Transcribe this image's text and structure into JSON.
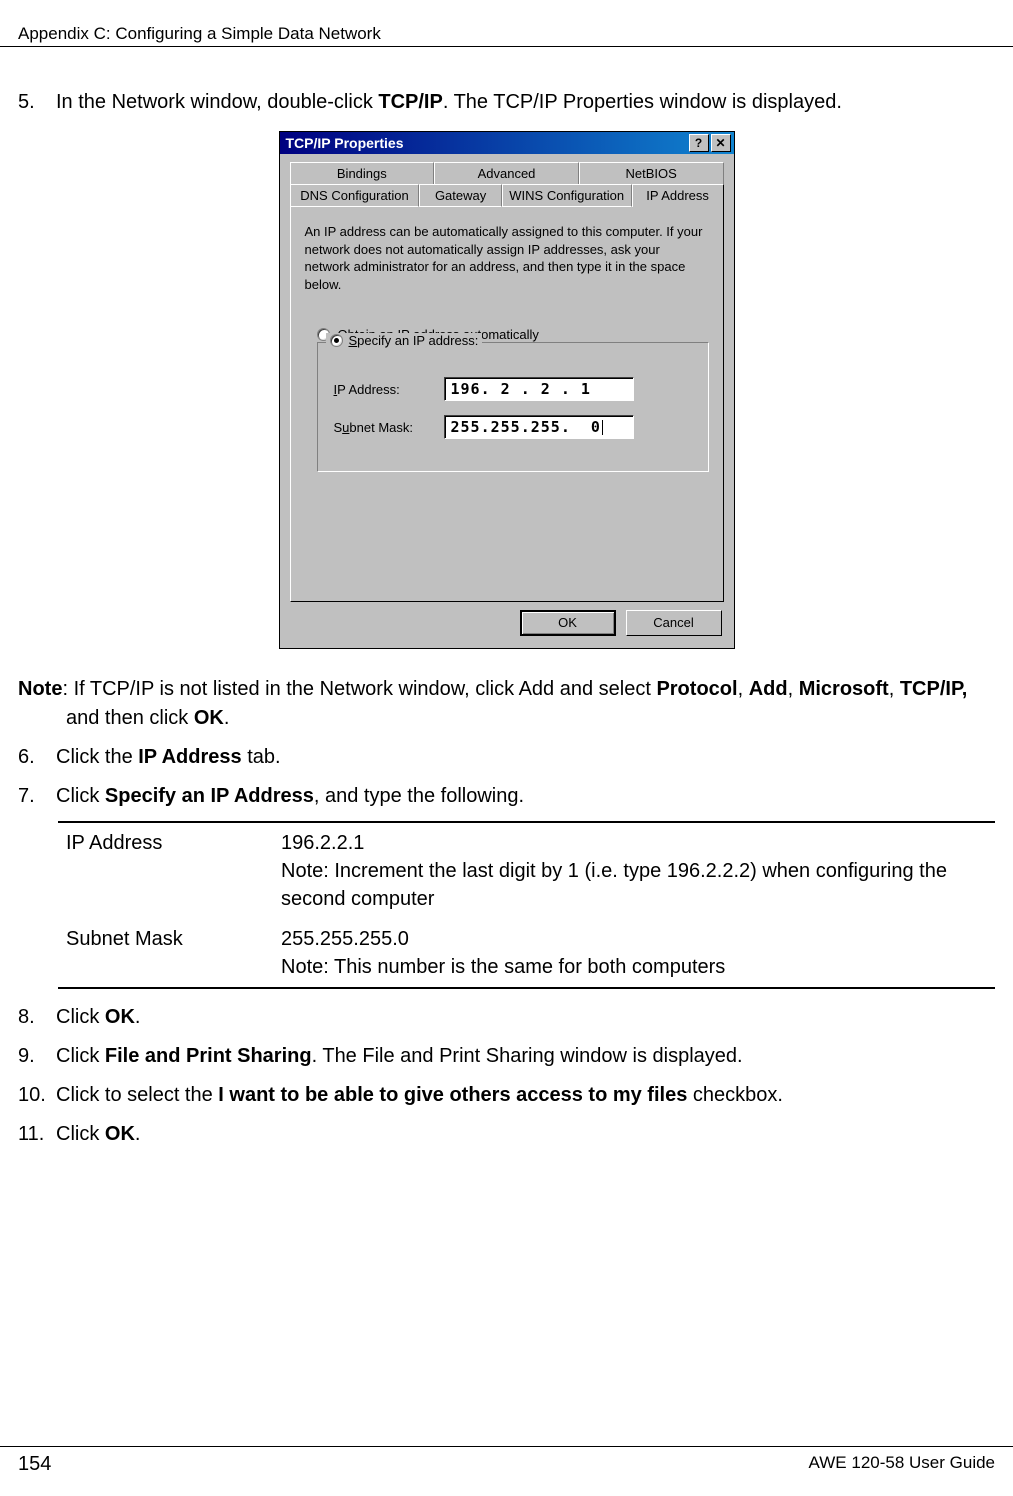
{
  "header": {
    "section_title": "Appendix C: Configuring a Simple Data Network"
  },
  "steps": {
    "s5": {
      "num": "5.",
      "pre": "In the Network window, double-click ",
      "bold1": "TCP/IP",
      "post": ". The TCP/IP Properties window is displayed."
    },
    "note": {
      "label": "Note",
      "text_a": ": If TCP/IP is not listed in the Network window, click Add and select ",
      "b1": "Protocol",
      "c1": ", ",
      "b2": "Add",
      "c2": ", ",
      "b3": "Microsoft",
      "c3": ", ",
      "b4": "TCP/IP,",
      "text_b": " and then click ",
      "b5": "OK",
      "text_c": "."
    },
    "s6": {
      "num": "6.",
      "a": "Click the ",
      "b": "IP Address",
      "c": " tab."
    },
    "s7": {
      "num": "7.",
      "a": "Click ",
      "b": "Specify an IP Address",
      "c": ", and type the following."
    },
    "s8": {
      "num": "8.",
      "a": "Click ",
      "b": "OK",
      "c": "."
    },
    "s9": {
      "num": "9.",
      "a": "Click ",
      "b": "File and Print Sharing",
      "c": ". The File and Print Sharing window is displayed."
    },
    "s10": {
      "num": "10.",
      "a": "Click to select the ",
      "b": "I want to be able to give others access to my files",
      "c": " checkbox."
    },
    "s11": {
      "num": "11.",
      "a": "Click ",
      "b": "OK",
      "c": "."
    }
  },
  "dialog": {
    "title": "TCP/IP Properties",
    "help": "?",
    "close": "✕",
    "tabs_row1": {
      "t1": "Bindings",
      "t2": "Advanced",
      "t3": "NetBIOS"
    },
    "tabs_row2": {
      "t1": "DNS Configuration",
      "t2": "Gateway",
      "t3": "WINS Configuration",
      "t4": "IP Address"
    },
    "desc": "An IP address can be automatically assigned to this computer. If your network does not automatically assign IP addresses, ask your network administrator for an address, and then type it in the space below.",
    "radio1_pre": "O",
    "radio1_label": "btain an IP address automatically",
    "radio2_pre": "S",
    "radio2_label": "pecify an IP address:",
    "ip_label_u": "I",
    "ip_label": "P Address:",
    "subnet_label_pre": "S",
    "subnet_label_u": "u",
    "subnet_label_post": "bnet Mask:",
    "ip_value": "196. 2 . 2 . 1",
    "subnet_value": "255.255.255.  0",
    "ok": "OK",
    "cancel": "Cancel"
  },
  "table": {
    "r1_label": "IP Address",
    "r1_val": "196.2.2.1",
    "r1_note": "Note: Increment the last digit by 1 (i.e. type 196.2.2.2) when configuring the second computer",
    "r2_label": "Subnet Mask",
    "r2_val": "255.255.255.0",
    "r2_note": "Note: This number is the same for both computers"
  },
  "footer": {
    "page": "154",
    "doc": "AWE 120-58 User Guide"
  }
}
